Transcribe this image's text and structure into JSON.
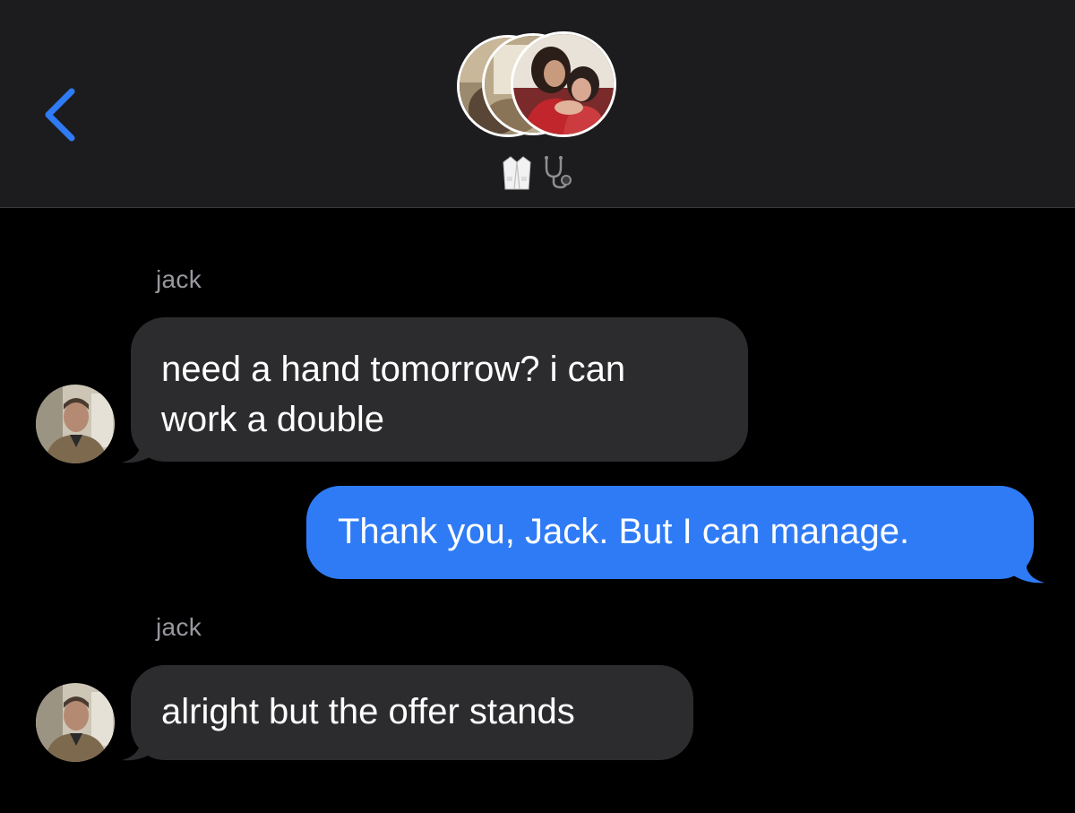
{
  "header": {
    "back_icon": "chevron-left-icon",
    "group_avatars": [
      "photo-avatar",
      "photo-avatar",
      "photo-avatar"
    ],
    "group_title_icons": [
      "lab-coat-emoji",
      "stethoscope-emoji"
    ]
  },
  "messages": [
    {
      "direction": "incoming",
      "sender": "jack",
      "text": "need a hand tomorrow? i can\nwork a double"
    },
    {
      "direction": "outgoing",
      "text": "Thank you, Jack. But I can manage."
    },
    {
      "direction": "incoming",
      "sender": "jack",
      "text": "alright but the offer stands"
    }
  ],
  "colors": {
    "background": "#000000",
    "header_background": "#1c1c1e",
    "incoming_bubble": "#2c2c2e",
    "outgoing_bubble": "#2f7bf6",
    "accent": "#2f7bf6",
    "sender_name": "#98989f"
  }
}
